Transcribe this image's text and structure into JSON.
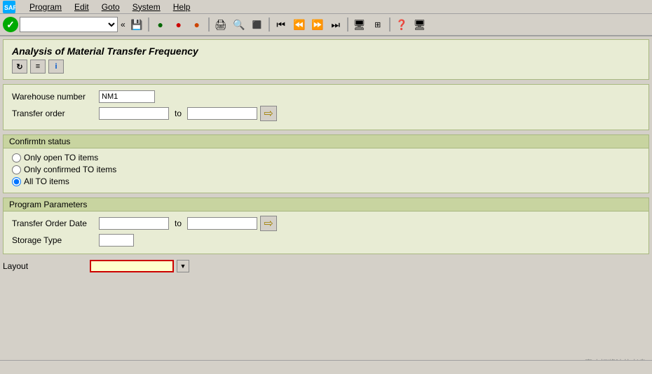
{
  "menubar": {
    "items": [
      {
        "id": "program",
        "label": "Program"
      },
      {
        "id": "edit",
        "label": "Edit"
      },
      {
        "id": "goto",
        "label": "Goto"
      },
      {
        "id": "system",
        "label": "System"
      },
      {
        "id": "help",
        "label": "Help"
      }
    ]
  },
  "title_panel": {
    "title": "Analysis of Material Transfer Frequency"
  },
  "form": {
    "warehouse_label": "Warehouse number",
    "warehouse_value": "NM1",
    "transfer_order_label": "Transfer order",
    "transfer_order_from": "",
    "transfer_order_to": "",
    "to_label": "to"
  },
  "confirmtn_status": {
    "section_title": "Confirmtn status",
    "options": [
      {
        "id": "open",
        "label": "Only open TO items",
        "checked": false
      },
      {
        "id": "confirmed",
        "label": "Only confirmed TO items",
        "checked": false
      },
      {
        "id": "all",
        "label": "All TO items",
        "checked": true
      }
    ]
  },
  "program_parameters": {
    "section_title": "Program Parameters",
    "transfer_order_date_label": "Transfer Order Date",
    "transfer_order_date_from": "",
    "transfer_order_date_to": "",
    "to_label": "to",
    "storage_type_label": "Storage Type",
    "storage_type_value": ""
  },
  "layout": {
    "label": "Layout",
    "value": ""
  },
  "watermark": "CSDN @喜欢打酱油的老鸟"
}
